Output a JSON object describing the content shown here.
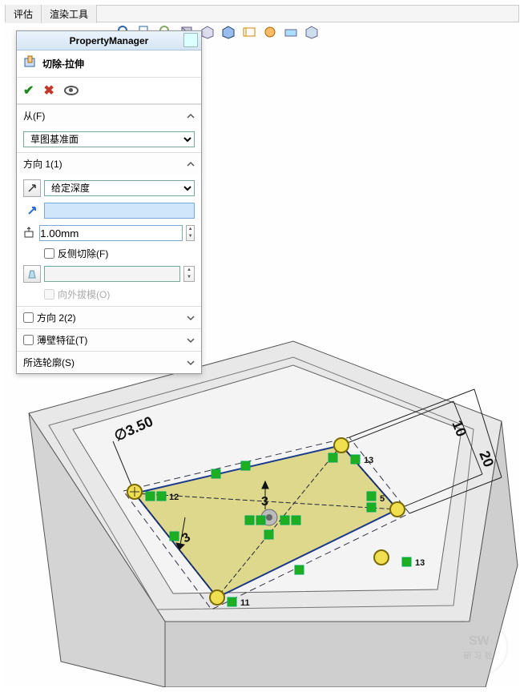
{
  "tabs": {
    "evaluate": "评估",
    "render": "渲染工具"
  },
  "pm": {
    "title": "PropertyManager",
    "feature": "切除-拉伸",
    "from": {
      "label": "从(F)",
      "option": "草图基准面"
    },
    "dir1": {
      "label": "方向 1(1)",
      "end": "给定深度",
      "val": "",
      "depth": "1.00mm",
      "flip": "反侧切除(F)",
      "draft": "向外拔模(O)"
    },
    "dir2": {
      "label": "方向 2(2)"
    },
    "thin": {
      "label": "薄壁特征(T)"
    },
    "contours": {
      "label": "所选轮廓(S)"
    }
  },
  "sketch": {
    "dims": {
      "diam": "∅3.50",
      "w": "20",
      "h": "10",
      "cx": "3",
      "cy": "3"
    },
    "rels": {
      "r5": "5",
      "r11": "11",
      "r12": "12",
      "r13a": "13",
      "r13b": "13"
    }
  },
  "wm": {
    "t1": "SW",
    "t2": "研习社"
  }
}
